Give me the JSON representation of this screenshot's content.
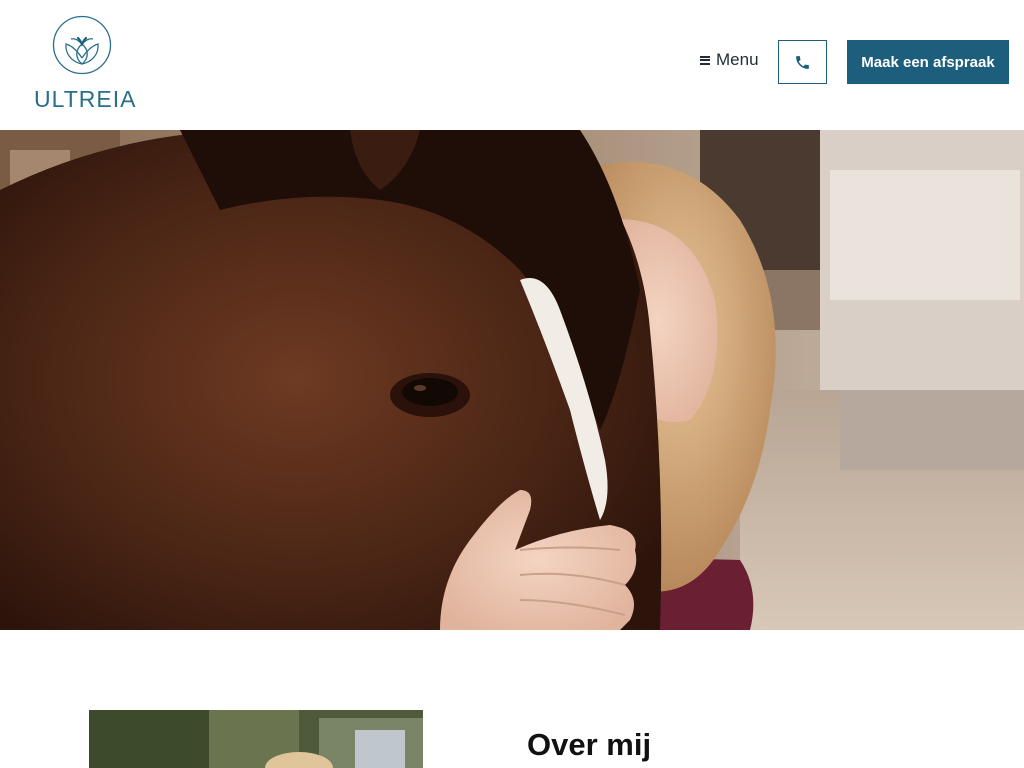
{
  "header": {
    "logo_text": "ULTREIA",
    "logo_icon": "lotus-icon",
    "menu_label": "Menu",
    "menu_icon": "hamburger-icon",
    "phone_icon": "phone-icon",
    "cta_label": "Maak een afspraak"
  },
  "hero": {
    "image": "woman-with-horse-photo"
  },
  "about": {
    "title": "Over mij",
    "image": "portrait-photo"
  },
  "colors": {
    "brand": "#1d5e7d",
    "logo": "#2a6f8a",
    "text": "#1f2d35"
  }
}
